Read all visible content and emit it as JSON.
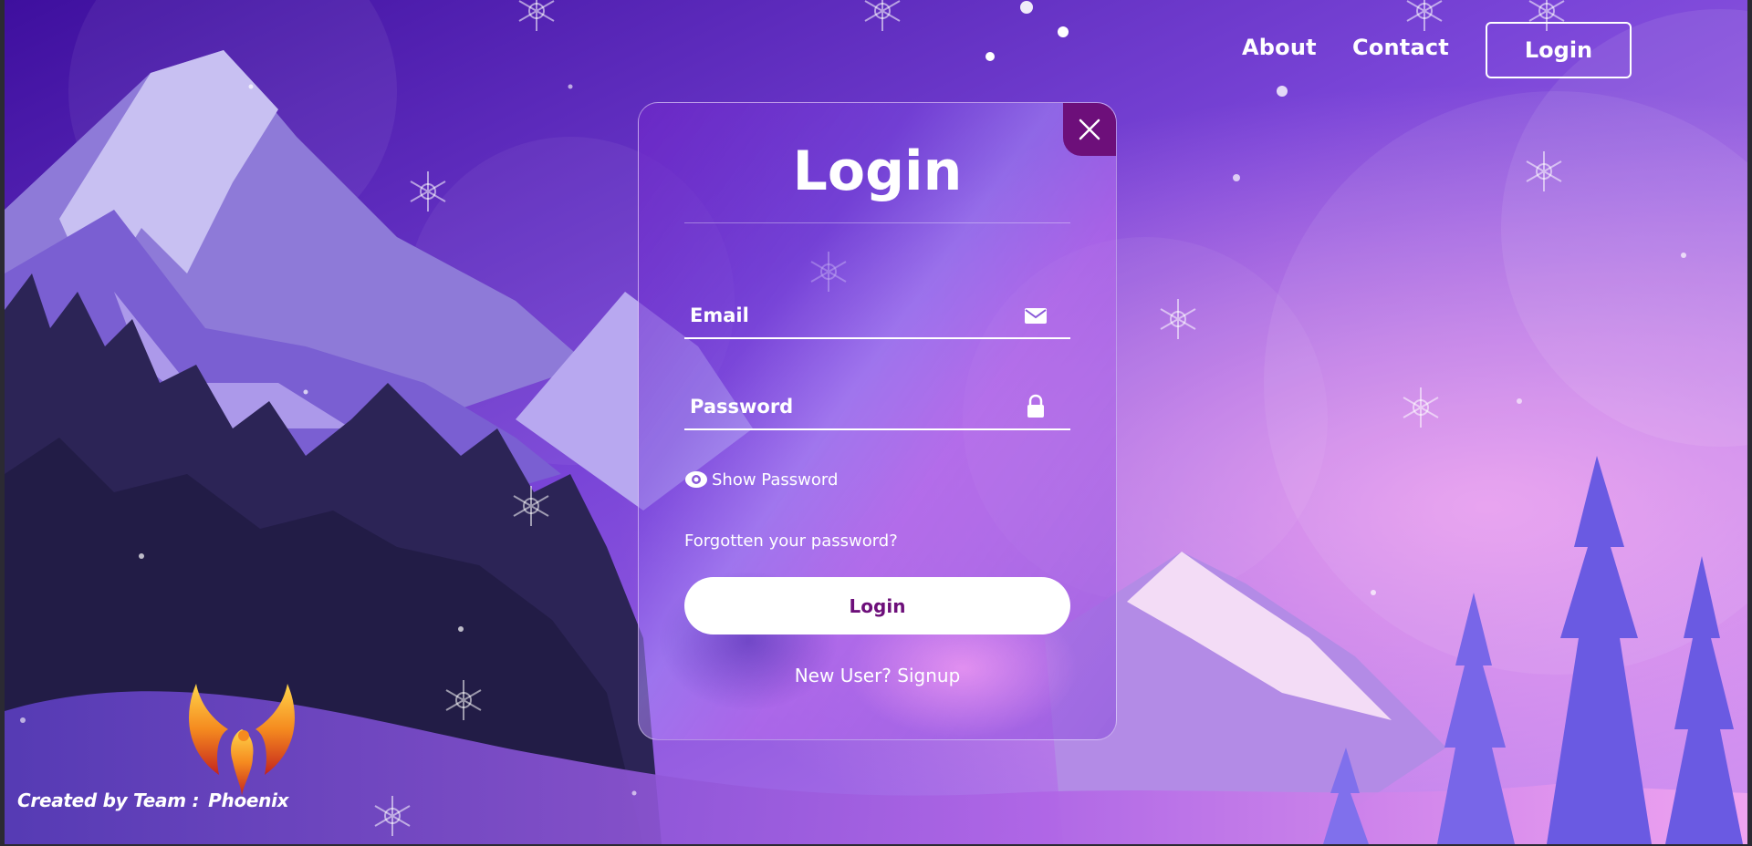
{
  "nav": {
    "about": "About",
    "contact": "Contact",
    "login": "Login"
  },
  "dialog": {
    "title": "Login",
    "close_icon": "close-icon",
    "email": {
      "placeholder": "Email",
      "value": "",
      "icon": "envelope-icon"
    },
    "password": {
      "placeholder": "Password",
      "value": "",
      "icon": "lock-icon"
    },
    "show_password": {
      "label": "Show Password",
      "icon": "eye-icon"
    },
    "forgot_password": "Forgotten your password?",
    "submit_label": "Login",
    "signup": {
      "prompt": "New User?",
      "link": "Signup"
    }
  },
  "footer": {
    "credit_prefix": "Created by Team :",
    "team_name": "Phoenix",
    "logo": "phoenix-logo"
  },
  "colors": {
    "accent": "#6d0f7a",
    "button_bg": "#ffffff",
    "text": "#ffffff"
  }
}
